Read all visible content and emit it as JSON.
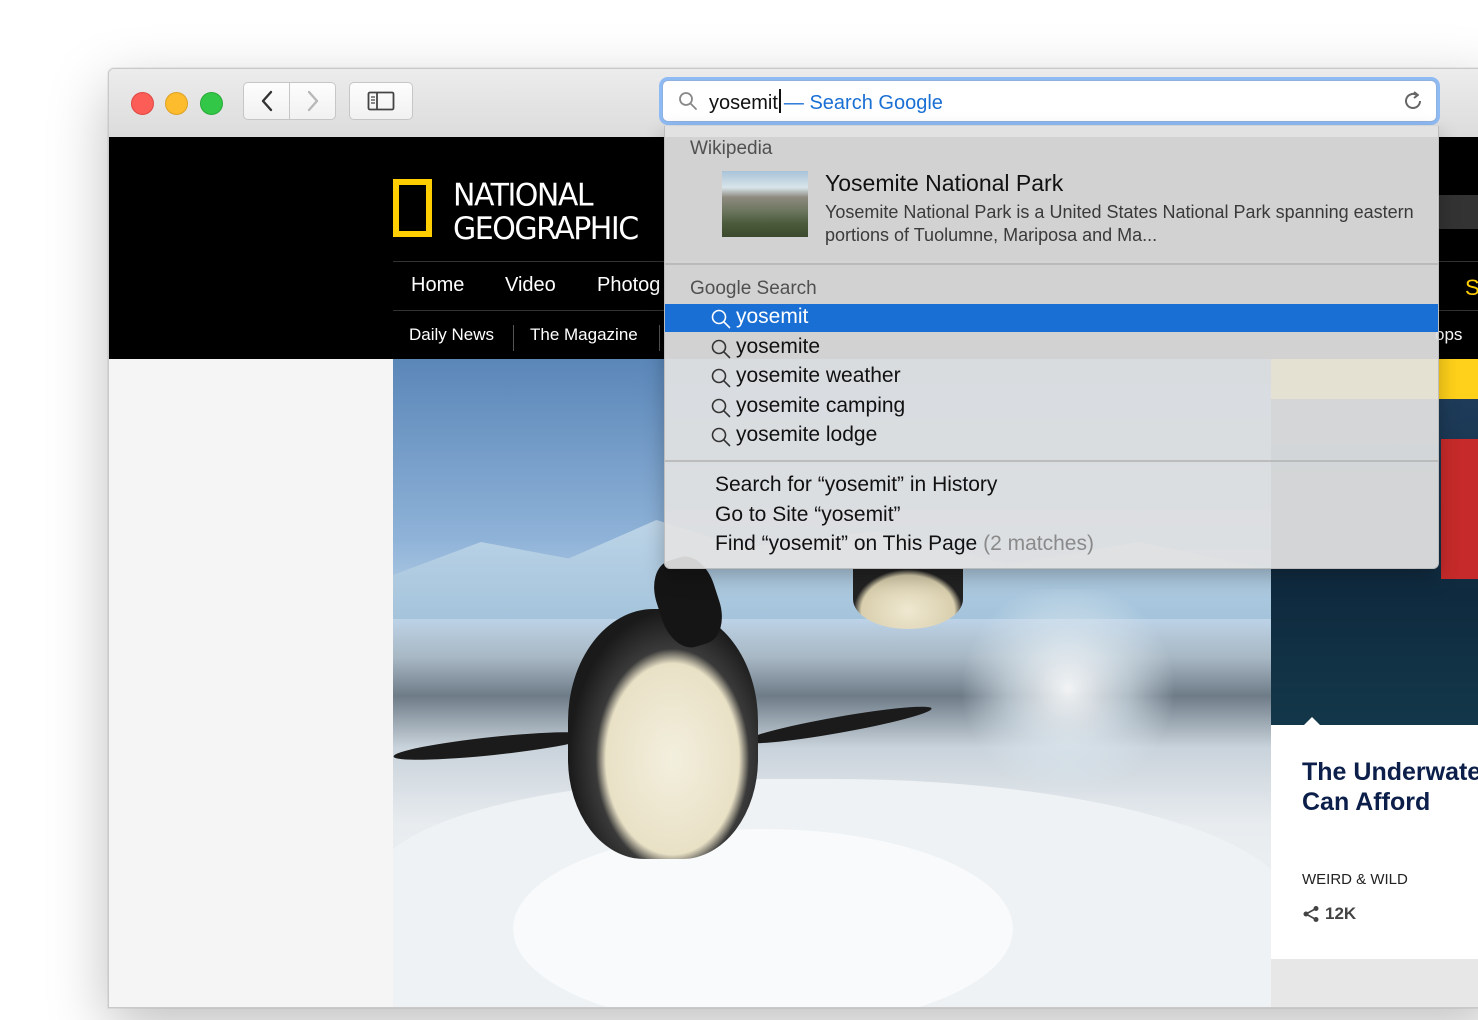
{
  "browser": {
    "url_typed": "yosemit",
    "url_hint": "— Search Google"
  },
  "site": {
    "logo": "NATIONAL GEOGRAPHIC",
    "logo_line1": "NATIONAL",
    "logo_line2": "GEOGRAPHIC",
    "nav": [
      "Home",
      "Video",
      "Photog"
    ],
    "nav_right": "S",
    "subnav": [
      "Daily News",
      "The Magazine"
    ],
    "subnav_right": "ops",
    "side_story": {
      "title_line1": "The Underwate",
      "title_line2": "Can Afford",
      "category": "WEIRD & WILD",
      "shares": "12K"
    }
  },
  "dropdown": {
    "wikipedia_header": "Wikipedia",
    "wiki_title": "Yosemite National Park",
    "wiki_desc": "Yosemite National Park is a United States National Park spanning eastern portions of Tuolumne, Mariposa and Ma...",
    "google_header": "Google Search",
    "suggestions": [
      "yosemit",
      "yosemite",
      "yosemite weather",
      "yosemite camping",
      "yosemite lodge"
    ],
    "actions": {
      "history": "Search for “yosemit” in History",
      "go_to_site": "Go to Site “yosemit”",
      "find_on_page": "Find “yosemit” on This Page",
      "matches": "(2 matches)"
    }
  },
  "colors": {
    "accent": "#1a6fd4",
    "ng_yellow": "#ffce00"
  }
}
